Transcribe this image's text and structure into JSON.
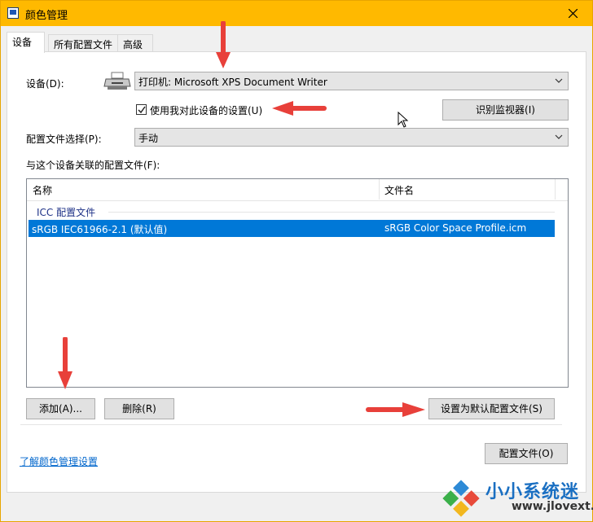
{
  "window": {
    "title": "颜色管理",
    "accent_color": "#ffb900"
  },
  "tabs": [
    {
      "label": "设备",
      "active": true
    },
    {
      "label": "所有配置文件",
      "active": false
    },
    {
      "label": "高级",
      "active": false
    }
  ],
  "device": {
    "label": "设备(D):",
    "icon": "printer-icon",
    "selected": "打印机: Microsoft XPS Document Writer"
  },
  "use_my_settings": {
    "label": "使用我对此设备的设置(U)",
    "checked": true
  },
  "identify_monitors_button": "识别监视器(I)",
  "profile_selection": {
    "label": "配置文件选择(P):",
    "selected": "手动"
  },
  "profiles_list": {
    "label": "与这个设备关联的配置文件(F):",
    "columns": [
      "名称",
      "文件名"
    ],
    "group": "ICC 配置文件",
    "rows": [
      {
        "name": "sRGB IEC61966-2.1 (默认值)",
        "file": "sRGB Color Space Profile.icm",
        "selected": true
      }
    ],
    "selection_color": "#0078d7"
  },
  "buttons": {
    "add": "添加(A)...",
    "remove": "删除(R)",
    "set_default": "设置为默认配置文件(S)",
    "profiles": "配置文件(O)"
  },
  "learn_more_link": "了解颜色管理设置",
  "annotation_arrow_color": "#e8403a",
  "watermark": {
    "text": "小小系统迷",
    "url": "www.jlovext.com"
  }
}
